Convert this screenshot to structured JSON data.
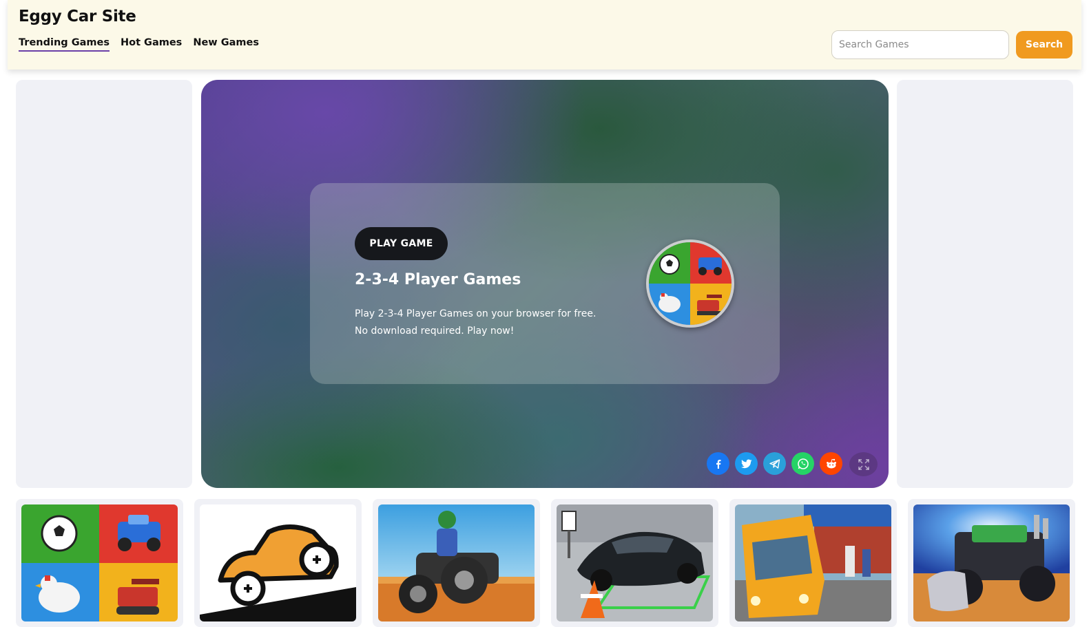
{
  "header": {
    "site_title": "Eggy Car Site",
    "nav": [
      {
        "label": "Trending Games",
        "active": true
      },
      {
        "label": "Hot Games",
        "active": false
      },
      {
        "label": "New Games",
        "active": false
      }
    ],
    "search": {
      "placeholder": "Search Games",
      "value": "",
      "button_label": "Search"
    }
  },
  "hero": {
    "play_label": "PLAY GAME",
    "title": "2-3-4 Player Games",
    "description": "Play 2-3-4 Player Games on your browser for free. No download required. Play now!",
    "game_icon": "2-3-4-player-games-icon",
    "share": [
      {
        "name": "facebook-icon",
        "color": "#1877f2"
      },
      {
        "name": "twitter-icon",
        "color": "#1d9bf0"
      },
      {
        "name": "telegram-icon",
        "color": "#2aa0da"
      },
      {
        "name": "whatsapp-icon",
        "color": "#25d366"
      },
      {
        "name": "reddit-icon",
        "color": "#ff4500"
      },
      {
        "name": "fullscreen-icon",
        "color": "#5a3a7a"
      }
    ]
  },
  "thumbnails": [
    {
      "name": "2-3-4-player-games-thumbnail",
      "art": "four-quadrant soccer, car, chicken, tank"
    },
    {
      "name": "eggy-car-thumbnail",
      "art": "orange cartoon car on hill"
    },
    {
      "name": "atv-racing-thumbnail",
      "art": "rider on quad bike in desert"
    },
    {
      "name": "car-parking-thumbnail",
      "art": "black supercar in parking spot with cone"
    },
    {
      "name": "bus-stop-thumbnail",
      "art": "yellow bus at stop"
    },
    {
      "name": "monster-truck-thumbnail",
      "art": "green monster truck with plow"
    }
  ],
  "colors": {
    "header_bg": "#fcf9e8",
    "accent_orange": "#f09a1f",
    "active_underline": "#6a3fa8",
    "side_panel_bg": "#f0f1f6"
  }
}
